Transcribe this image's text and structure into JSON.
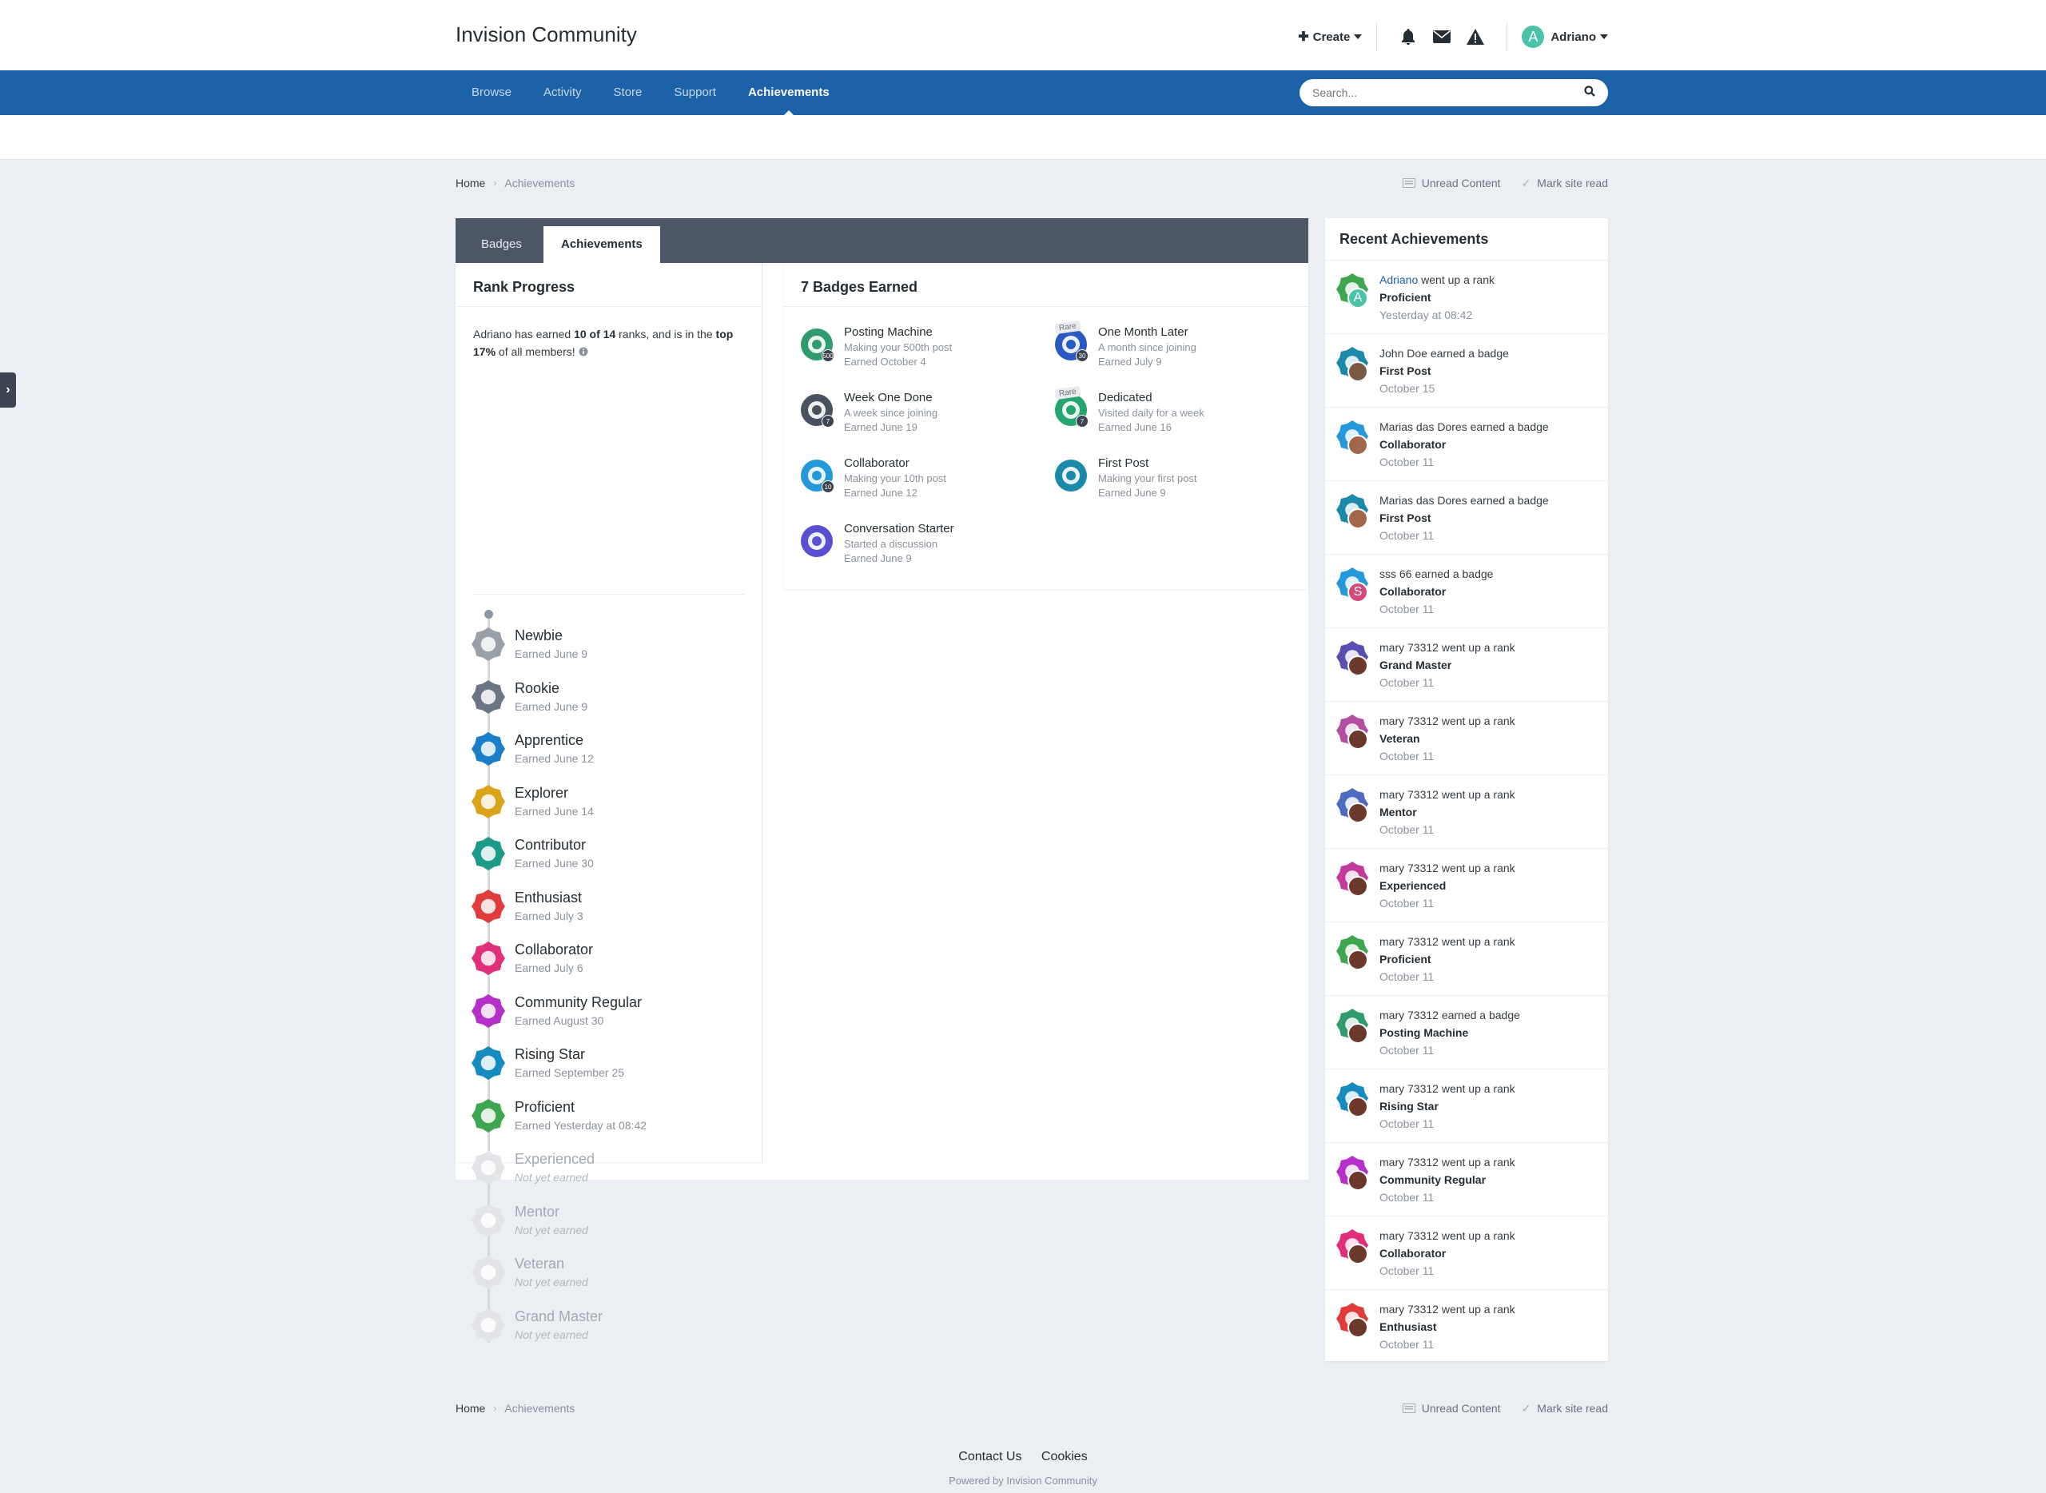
{
  "header": {
    "site_title": "Invision Community",
    "create_label": "Create",
    "user_name": "Adriano",
    "user_initial": "A"
  },
  "nav": {
    "items": [
      {
        "label": "Browse"
      },
      {
        "label": "Activity"
      },
      {
        "label": "Store"
      },
      {
        "label": "Support"
      },
      {
        "label": "Achievements"
      }
    ],
    "active": "Achievements",
    "search_placeholder": "Search..."
  },
  "breadcrumb": {
    "home": "Home",
    "current": "Achievements",
    "unread_content": "Unread Content",
    "mark_read": "Mark site read"
  },
  "tabs": [
    {
      "label": "Badges"
    },
    {
      "label": "Achievements"
    }
  ],
  "rank_progress": {
    "title": "Rank Progress",
    "summary_prefix": "Adriano has earned ",
    "summary_count": "10 of 14",
    "summary_middle": " ranks, and is in the ",
    "summary_top": "top 17%",
    "summary_suffix": " of all members!",
    "ranks": [
      {
        "name": "Newbie",
        "date": "Earned June 9",
        "color": "#9aa0a8",
        "earned": true
      },
      {
        "name": "Rookie",
        "date": "Earned June 9",
        "color": "#6c7585",
        "earned": true
      },
      {
        "name": "Apprentice",
        "date": "Earned June 12",
        "color": "#1a7fc8",
        "earned": true
      },
      {
        "name": "Explorer",
        "date": "Earned June 14",
        "color": "#d9a419",
        "earned": true
      },
      {
        "name": "Contributor",
        "date": "Earned June 30",
        "color": "#1d9a8a",
        "earned": true
      },
      {
        "name": "Enthusiast",
        "date": "Earned July 3",
        "color": "#e03c3c",
        "earned": true
      },
      {
        "name": "Collaborator",
        "date": "Earned July 6",
        "color": "#e0307a",
        "earned": true
      },
      {
        "name": "Community Regular",
        "date": "Earned August 30",
        "color": "#b52fc9",
        "earned": true
      },
      {
        "name": "Rising Star",
        "date": "Earned September 25",
        "color": "#168bbf",
        "earned": true
      },
      {
        "name": "Proficient",
        "date": "Earned Yesterday at 08:42",
        "color": "#3ea651",
        "earned": true
      },
      {
        "name": "Experienced",
        "date": "Not yet earned",
        "color": "#e2e4e7",
        "earned": false
      },
      {
        "name": "Mentor",
        "date": "Not yet earned",
        "color": "#e2e4e7",
        "earned": false
      },
      {
        "name": "Veteran",
        "date": "Not yet earned",
        "color": "#e2e4e7",
        "earned": false
      },
      {
        "name": "Grand Master",
        "date": "Not yet earned",
        "color": "#e2e4e7",
        "earned": false
      }
    ]
  },
  "badges": {
    "title": "7 Badges Earned",
    "rare_label": "Rare",
    "items": [
      {
        "name": "Posting Machine",
        "desc": "Making your 500th post",
        "date": "Earned October 4",
        "color": "#2f9b6f",
        "icon": "plus-icon",
        "count": "500",
        "rare": false
      },
      {
        "name": "One Month Later",
        "desc": "A month since joining",
        "date": "Earned July 9",
        "color": "#2b59c3",
        "icon": "clock-icon",
        "count": "30",
        "rare": true
      },
      {
        "name": "Week One Done",
        "desc": "A week since joining",
        "date": "Earned June 19",
        "color": "#4a5260",
        "icon": "clock-icon",
        "count": "7",
        "rare": false
      },
      {
        "name": "Dedicated",
        "desc": "Visited daily for a week",
        "date": "Earned June 16",
        "color": "#23a76e",
        "icon": "arrow-icon",
        "count": "7",
        "rare": true
      },
      {
        "name": "Collaborator",
        "desc": "Making your 10th post",
        "date": "Earned June 12",
        "color": "#2598d9",
        "icon": "chat-icon",
        "count": "10",
        "rare": false
      },
      {
        "name": "First Post",
        "desc": "Making your first post",
        "date": "Earned June 9",
        "color": "#1a8aa8",
        "icon": "chat-icon",
        "count": "",
        "rare": false
      },
      {
        "name": "Conversation Starter",
        "desc": "Started a discussion",
        "date": "Earned June 9",
        "color": "#5a4fd0",
        "icon": "plus-icon",
        "count": "",
        "rare": false
      }
    ]
  },
  "recent": {
    "title": "Recent Achievements",
    "items": [
      {
        "actor": "Adriano",
        "actor_link": true,
        "action": " went up a rank",
        "item": "Proficient",
        "date": "Yesterday at 08:42",
        "badge_color": "#3ea651",
        "avatar_color": "#4ac3a8",
        "avatar_letter": "A"
      },
      {
        "actor": "John Doe",
        "actor_link": false,
        "action": " earned a badge",
        "item": "First Post",
        "date": "October 15",
        "badge_color": "#1a8aa8",
        "avatar_color": "#7b5a44",
        "avatar_letter": ""
      },
      {
        "actor": "Marias das Dores",
        "actor_link": false,
        "action": " earned a badge",
        "item": "Collaborator",
        "date": "October 11",
        "badge_color": "#2598d9",
        "avatar_color": "#a2674a",
        "avatar_letter": ""
      },
      {
        "actor": "Marias das Dores",
        "actor_link": false,
        "action": " earned a badge",
        "item": "First Post",
        "date": "October 11",
        "badge_color": "#1a8aa8",
        "avatar_color": "#a2674a",
        "avatar_letter": ""
      },
      {
        "actor": "sss 66",
        "actor_link": false,
        "action": " earned a badge",
        "item": "Collaborator",
        "date": "October 11",
        "badge_color": "#2598d9",
        "avatar_color": "#d04a7c",
        "avatar_letter": "S"
      },
      {
        "actor": "mary 73312",
        "actor_link": false,
        "action": " went up a rank",
        "item": "Grand Master",
        "date": "October 11",
        "badge_color": "#5a4fb0",
        "avatar_color": "#6b3a2c",
        "avatar_letter": ""
      },
      {
        "actor": "mary 73312",
        "actor_link": false,
        "action": " went up a rank",
        "item": "Veteran",
        "date": "October 11",
        "badge_color": "#b24fa0",
        "avatar_color": "#6b3a2c",
        "avatar_letter": ""
      },
      {
        "actor": "mary 73312",
        "actor_link": false,
        "action": " went up a rank",
        "item": "Mentor",
        "date": "October 11",
        "badge_color": "#4f6bc0",
        "avatar_color": "#6b3a2c",
        "avatar_letter": ""
      },
      {
        "actor": "mary 73312",
        "actor_link": false,
        "action": " went up a rank",
        "item": "Experienced",
        "date": "October 11",
        "badge_color": "#c23a9a",
        "avatar_color": "#6b3a2c",
        "avatar_letter": ""
      },
      {
        "actor": "mary 73312",
        "actor_link": false,
        "action": " went up a rank",
        "item": "Proficient",
        "date": "October 11",
        "badge_color": "#3ea651",
        "avatar_color": "#6b3a2c",
        "avatar_letter": ""
      },
      {
        "actor": "mary 73312",
        "actor_link": false,
        "action": " earned a badge",
        "item": "Posting Machine",
        "date": "October 11",
        "badge_color": "#2f9b6f",
        "avatar_color": "#6b3a2c",
        "avatar_letter": ""
      },
      {
        "actor": "mary 73312",
        "actor_link": false,
        "action": " went up a rank",
        "item": "Rising Star",
        "date": "October 11",
        "badge_color": "#168bbf",
        "avatar_color": "#6b3a2c",
        "avatar_letter": ""
      },
      {
        "actor": "mary 73312",
        "actor_link": false,
        "action": " went up a rank",
        "item": "Community Regular",
        "date": "October 11",
        "badge_color": "#b52fc9",
        "avatar_color": "#6b3a2c",
        "avatar_letter": ""
      },
      {
        "actor": "mary 73312",
        "actor_link": false,
        "action": " went up a rank",
        "item": "Collaborator",
        "date": "October 11",
        "badge_color": "#e0307a",
        "avatar_color": "#6b3a2c",
        "avatar_letter": ""
      },
      {
        "actor": "mary 73312",
        "actor_link": false,
        "action": " went up a rank",
        "item": "Enthusiast",
        "date": "October 11",
        "badge_color": "#e03c3c",
        "avatar_color": "#6b3a2c",
        "avatar_letter": ""
      }
    ]
  },
  "footer": {
    "contact": "Contact Us",
    "cookies": "Cookies",
    "powered": "Powered by Invision Community"
  }
}
